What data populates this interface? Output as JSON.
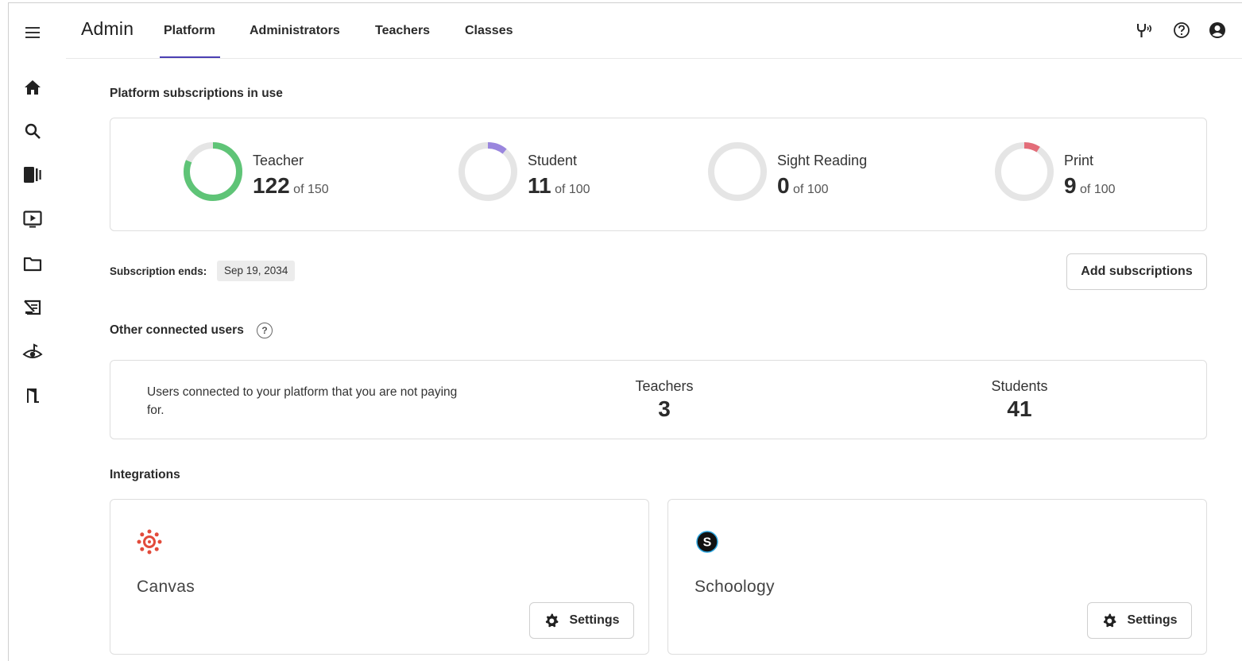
{
  "header": {
    "app_title": "Admin",
    "tabs": [
      {
        "label": "Platform",
        "active": true
      },
      {
        "label": "Administrators"
      },
      {
        "label": "Teachers"
      },
      {
        "label": "Classes"
      }
    ],
    "accent_color": "#4b3fb3",
    "icons": [
      "menu-icon",
      "antenna-icon",
      "help-icon",
      "account-icon"
    ]
  },
  "rail": {
    "items": [
      "home-icon",
      "search-icon",
      "library-icon",
      "video-icon",
      "folder-icon",
      "sight-reading-icon",
      "listen-icon",
      "exit-icon"
    ]
  },
  "subscriptions": {
    "title": "Platform subscriptions in use",
    "items": [
      {
        "label": "Teacher",
        "used": "122",
        "of_text": "of 150",
        "used_value": 122,
        "total": 150,
        "color": "#5fc477"
      },
      {
        "label": "Student",
        "used": "11",
        "of_text": "of 100",
        "used_value": 11,
        "total": 100,
        "color": "#9a86de"
      },
      {
        "label": "Sight Reading",
        "used": "0",
        "of_text": "of 100",
        "used_value": 0,
        "total": 100,
        "color": "#bdbdbd"
      },
      {
        "label": "Print",
        "used": "9",
        "of_text": "of 100",
        "used_value": 9,
        "total": 100,
        "color": "#e36d79"
      }
    ],
    "ring_track_color": "#e5e5e5",
    "ends_label": "Subscription ends:",
    "ends_date": "Sep 19, 2034",
    "add_button": "Add subscriptions"
  },
  "connected": {
    "title": "Other connected users",
    "help_glyph": "?",
    "description": "Users connected to your platform that you are not paying for.",
    "teachers_label": "Teachers",
    "teachers_count": "3",
    "students_label": "Students",
    "students_count": "41"
  },
  "integrations": {
    "title": "Integrations",
    "items": [
      {
        "name": "Canvas",
        "settings_label": "Settings",
        "logo_color": "#e24b3b"
      },
      {
        "name": "Schoology",
        "settings_label": "Settings",
        "logo_color": "#111111"
      }
    ]
  }
}
